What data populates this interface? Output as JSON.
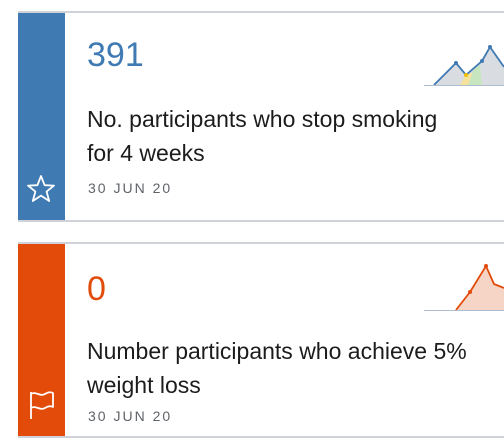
{
  "cards": [
    {
      "value": "391",
      "title": "No. participants who stop smoking for 4 weeks",
      "date": "30 JUN 20",
      "status_icon": "star-outline-icon",
      "accent": "#3f7ab3",
      "sparkline": {
        "trend": [
          2,
          6,
          9,
          4,
          8,
          12
        ],
        "fill": "#d6dde6"
      }
    },
    {
      "value": "0",
      "title": "Number participants who achieve 5% weight loss",
      "date": "30 JUN 20",
      "status_icon": "flag-outline-icon",
      "accent": "#e24b0a",
      "sparkline": {
        "trend": [
          1,
          4,
          10,
          2
        ],
        "fill": "#f6d5c6"
      }
    }
  ]
}
